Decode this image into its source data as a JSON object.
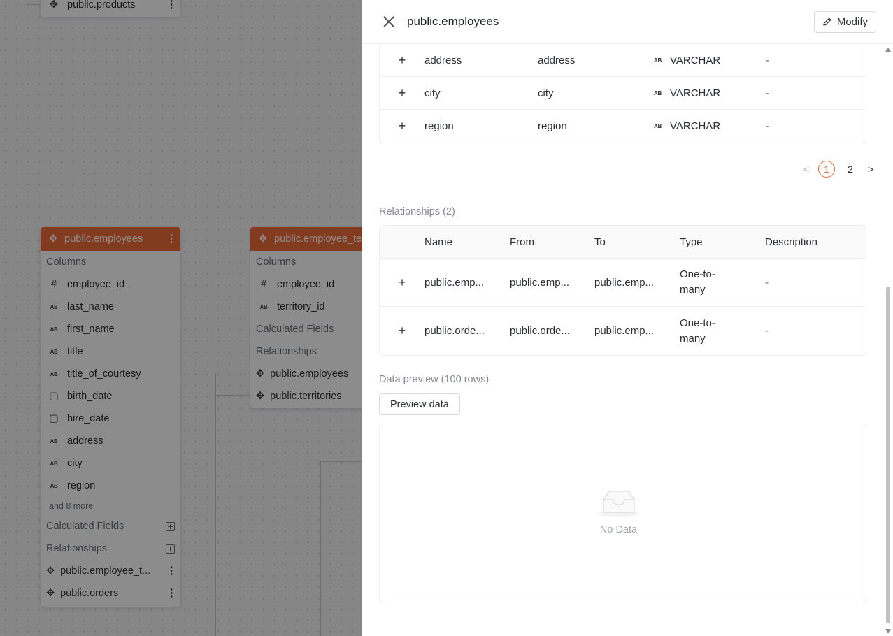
{
  "canvas": {
    "products_card": {
      "title": "public.products"
    },
    "employees_card": {
      "title": "public.employees",
      "columns_label": "Columns",
      "columns": [
        {
          "icon": "hash-icon",
          "glyph": "#",
          "name": "employee_id"
        },
        {
          "icon": "text-type-icon",
          "glyph": "AB",
          "name": "last_name"
        },
        {
          "icon": "text-type-icon",
          "glyph": "AB",
          "name": "first_name"
        },
        {
          "icon": "text-type-icon",
          "glyph": "AB",
          "name": "title"
        },
        {
          "icon": "text-type-icon",
          "glyph": "AB",
          "name": "title_of_courtesy"
        },
        {
          "icon": "calendar-icon",
          "glyph": "▢",
          "name": "birth_date"
        },
        {
          "icon": "calendar-icon",
          "glyph": "▢",
          "name": "hire_date"
        },
        {
          "icon": "text-type-icon",
          "glyph": "AB",
          "name": "address"
        },
        {
          "icon": "text-type-icon",
          "glyph": "AB",
          "name": "city"
        },
        {
          "icon": "text-type-icon",
          "glyph": "AB",
          "name": "region"
        }
      ],
      "more_text": "and 8 more",
      "calculated_label": "Calculated Fields",
      "relationships_label": "Relationships",
      "relationships": [
        {
          "name": "public.employee_t..."
        },
        {
          "name": "public.orders"
        }
      ]
    },
    "employee_territories_card": {
      "title": "public.employee_te",
      "columns_label": "Columns",
      "columns": [
        {
          "icon": "hash-icon",
          "glyph": "#",
          "name": "employee_id"
        },
        {
          "icon": "text-type-icon",
          "glyph": "AB",
          "name": "territory_id"
        }
      ],
      "calculated_label": "Calculated Fields",
      "relationships_label": "Relationships",
      "relationships": [
        {
          "name": "public.employees"
        },
        {
          "name": "public.territories"
        }
      ]
    }
  },
  "drawer": {
    "title": "public.employees",
    "modify_label": "Modify",
    "columns_rows": [
      {
        "name": "address",
        "alias": "address",
        "type": "VARCHAR",
        "description": "-"
      },
      {
        "name": "city",
        "alias": "city",
        "type": "VARCHAR",
        "description": "-"
      },
      {
        "name": "region",
        "alias": "region",
        "type": "VARCHAR",
        "description": "-"
      }
    ],
    "pagination": {
      "pages": [
        "1",
        "2"
      ],
      "current": "1"
    },
    "relationships": {
      "title": "Relationships (2)",
      "headers": [
        "Name",
        "From",
        "To",
        "Type",
        "Description"
      ],
      "rows": [
        {
          "name": "public.emp...",
          "from": "public.emp...",
          "to": "public.emp...",
          "type": "One-to-many",
          "description": "-"
        },
        {
          "name": "public.orde...",
          "from": "public.orde...",
          "to": "public.emp...",
          "type": "One-to-many",
          "description": "-"
        }
      ]
    },
    "data_preview": {
      "title": "Data preview (100 rows)",
      "button_label": "Preview data",
      "empty_text": "No Data"
    }
  }
}
